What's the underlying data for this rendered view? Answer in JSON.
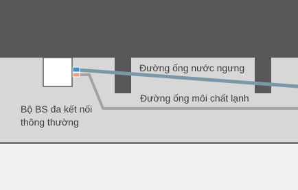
{
  "labels": {
    "drain_pipe": "Đường ống nước ngưng",
    "refrigerant_pipe": "Đường ống môi chất lạnh",
    "bs_unit_line1": "Bộ BS đa kết nối",
    "bs_unit_line2": "thông thường"
  },
  "colors": {
    "ceiling_dark": "#58585a",
    "ceiling_void": "#d7d7d7",
    "room": "#f1f1f1",
    "ceiling_board": "#7a7a7a",
    "beam": "#58585a",
    "drain_pipe": "#7c98a6",
    "refrigerant_pipe": "#a3a3a3",
    "unit_box_fill": "#ffffff",
    "unit_box_stroke": "#5a5a5a",
    "port_blue": "#3b8fcf",
    "port_orange": "#e5a282",
    "text": "#3a3a3a"
  }
}
